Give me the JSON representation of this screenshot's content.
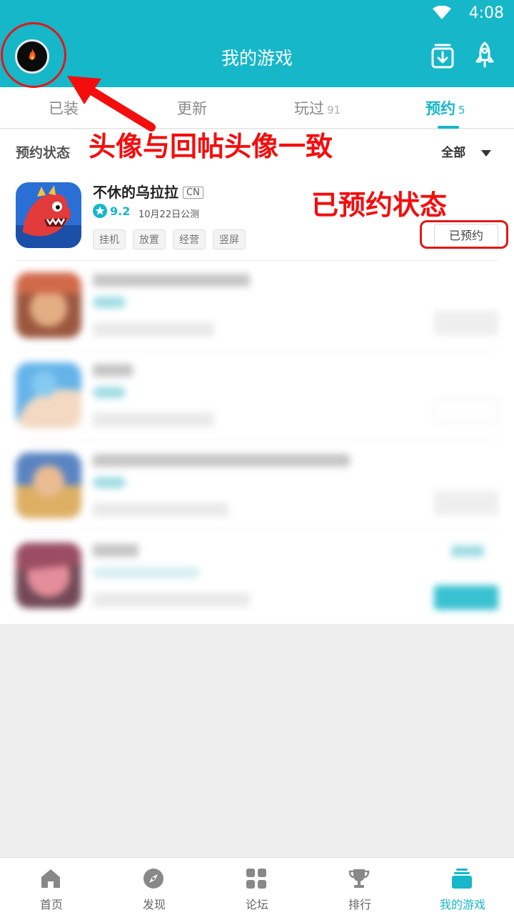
{
  "status_bar": {
    "time": "4:08"
  },
  "app_bar": {
    "title": "我的游戏"
  },
  "tabs": [
    {
      "label": "已装",
      "count": ""
    },
    {
      "label": "更新",
      "count": ""
    },
    {
      "label": "玩过",
      "count": "91"
    },
    {
      "label": "预约",
      "count": "5"
    }
  ],
  "active_tab": "预约",
  "filter": {
    "label": "预约状态",
    "dropdown_value": "全部"
  },
  "games": [
    {
      "name": "不休的乌拉拉",
      "badge": "CN",
      "rating": "9.2",
      "release": "10月22日公测",
      "tags": [
        "挂机",
        "放置",
        "经营",
        "竖屏"
      ],
      "action": "已预约"
    }
  ],
  "annotations": {
    "avatar_note": "头像与回帖头像一致",
    "status_note": "已预约状态"
  },
  "bottom_nav": [
    {
      "label": "首页",
      "icon": "home-icon"
    },
    {
      "label": "发现",
      "icon": "compass-icon"
    },
    {
      "label": "论坛",
      "icon": "grid-icon"
    },
    {
      "label": "排行",
      "icon": "trophy-icon"
    },
    {
      "label": "我的游戏",
      "icon": "stack-icon"
    }
  ],
  "colors": {
    "accent": "#15b7c9",
    "annotation": "#f40d0d"
  }
}
